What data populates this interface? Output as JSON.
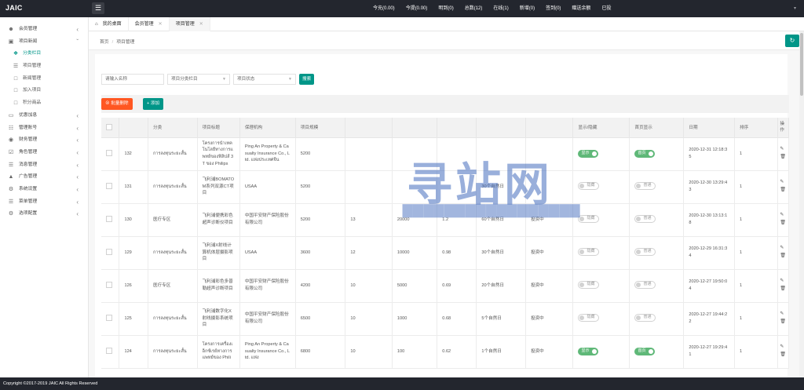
{
  "app": {
    "logo": "JAIC",
    "menu_icon": "menu-icon"
  },
  "topnav": [
    {
      "label": "今充(0.00)"
    },
    {
      "label": "今提(0.00)"
    },
    {
      "label": "明到(0)"
    },
    {
      "label": "总数(12)"
    },
    {
      "label": "在线(1)"
    },
    {
      "label": "新增(0)"
    },
    {
      "label": "签到(0)"
    },
    {
      "label": "赠送余额"
    },
    {
      "label": "已投"
    }
  ],
  "sidebar": {
    "items": [
      {
        "label": "会员管理",
        "icon": "user-icon",
        "type": "group"
      },
      {
        "label": "项目新闻",
        "icon": "news-icon",
        "type": "group"
      },
      {
        "label": "分类栏目",
        "icon": "bullet-icon",
        "type": "sub",
        "active": true
      },
      {
        "label": "项目管理",
        "icon": "cart-icon",
        "type": "sub"
      },
      {
        "label": "新闻管理",
        "icon": "doc-icon",
        "type": "sub"
      },
      {
        "label": "加入项目",
        "icon": "doc-icon",
        "type": "sub"
      },
      {
        "label": "积分商品",
        "icon": "gift-icon",
        "type": "sub"
      },
      {
        "label": "优惠加息",
        "icon": "coupon-icon",
        "type": "group"
      },
      {
        "label": "管理账号",
        "icon": "account-icon",
        "type": "group"
      },
      {
        "label": "财务管理",
        "icon": "finance-icon",
        "type": "group"
      },
      {
        "label": "角色管理",
        "icon": "role-icon",
        "type": "group"
      },
      {
        "label": "消息管理",
        "icon": "message-icon",
        "type": "group"
      },
      {
        "label": "广告管理",
        "icon": "ad-icon",
        "type": "group"
      },
      {
        "label": "系统设置",
        "icon": "settings-icon",
        "type": "group"
      },
      {
        "label": "菜单管理",
        "icon": "menu-list-icon",
        "type": "group"
      },
      {
        "label": "选项配置",
        "icon": "config-icon",
        "type": "group"
      }
    ]
  },
  "tabs": [
    {
      "label": "我的桌面",
      "closable": false
    },
    {
      "label": "会员管理",
      "closable": true
    },
    {
      "label": "项目管理",
      "closable": true,
      "active": true
    }
  ],
  "breadcrumb": {
    "home": "首页",
    "separator": "/",
    "current": "项目管理"
  },
  "search": {
    "name_placeholder": "请输入名称",
    "category_placeholder": "项目分类栏目",
    "status_placeholder": "项目状态",
    "search_label": "搜索"
  },
  "toolbar": {
    "batch_delete_label": "批量删除",
    "add_label": "添加"
  },
  "table": {
    "headers": [
      "",
      "",
      "分类",
      "项目标题",
      "保理机构",
      "项目规模",
      "",
      "",
      "",
      "",
      "",
      "显示/隐藏",
      "首页显示",
      "日期",
      "排序",
      "操作"
    ],
    "rows": [
      {
        "id": "132",
        "category": "การลงทุนระยะสั้น",
        "title": "โครงการนำเทคโนโลยีทางการแพทย์ของฟิลิปส์ 3T ของ Philips",
        "institution": "Ping An Property & Casualty Insurance Co., Ltd. แห่งประเทศจีน",
        "scale": "5200",
        "c6": "",
        "c7": "",
        "c8": "",
        "c9": "",
        "c10": "",
        "show": "显示",
        "show_on": true,
        "home": "首页",
        "home_on": true,
        "date": "2020-12-31 12:18:35",
        "sort": "1"
      },
      {
        "id": "131",
        "category": "การลงทุนระยะสั้น",
        "title": "飞利浦BOMATOM系列双源CT项目",
        "institution": "USAA",
        "scale": "5200",
        "c6": "",
        "c7": "",
        "c8": "",
        "c9": "30个自然日",
        "c10": "",
        "show": "隐藏",
        "show_on": false,
        "home": "普通",
        "home_on": false,
        "date": "2020-12-30 13:29:43",
        "sort": "1"
      },
      {
        "id": "130",
        "category": "医疗专区",
        "title": "飞利浦便携彩色超声诊断仪项目",
        "institution": "中国平安财产保险股份有限公司",
        "scale": "5200",
        "c6": "13",
        "c7": "20000",
        "c8": "1.2",
        "c9": "60个自然日",
        "c10": "投资中",
        "show": "隐藏",
        "show_on": false,
        "home": "普通",
        "home_on": false,
        "date": "2020-12-30 13:13:18",
        "sort": "1"
      },
      {
        "id": "129",
        "category": "การลงทุนระยะสั้น",
        "title": "飞利浦X射线计算机体层摄影项目",
        "institution": "USAA",
        "scale": "3600",
        "c6": "12",
        "c7": "10000",
        "c8": "0.98",
        "c9": "30个自然日",
        "c10": "投资中",
        "show": "隐藏",
        "show_on": false,
        "home": "普通",
        "home_on": false,
        "date": "2020-12-29 16:31:34",
        "sort": "1"
      },
      {
        "id": "126",
        "category": "医疗专区",
        "title": "飞利浦彩色多普勒超声诊断项目",
        "institution": "中国平安财产保险股份有限公司",
        "scale": "4200",
        "c6": "10",
        "c7": "5000",
        "c8": "0.69",
        "c9": "20个自然日",
        "c10": "投资中",
        "show": "隐藏",
        "show_on": false,
        "home": "普通",
        "home_on": false,
        "date": "2020-12-27 19:50:04",
        "sort": "1"
      },
      {
        "id": "125",
        "category": "การลงทุนระยะสั้น",
        "title": "飞利浦数字化X射线摄影系统项目",
        "institution": "中国平安财产保险股份有限公司",
        "scale": "6500",
        "c6": "10",
        "c7": "1000",
        "c8": "0.68",
        "c9": "5个自然日",
        "c10": "投资中",
        "show": "隐藏",
        "show_on": false,
        "home": "普通",
        "home_on": false,
        "date": "2020-12-27 19:44:22",
        "sort": "1"
      },
      {
        "id": "124",
        "category": "การลงทุนระยะสั้น",
        "title": "โครงการเครื่องเอ็กซ์เรย์ทางการแพทย์ของ Phili",
        "institution": "Ping An Property & Casualty Insurance Co., Ltd. แห่ง",
        "scale": "6800",
        "c6": "10",
        "c7": "100",
        "c8": "0.62",
        "c9": "1个自然日",
        "c10": "投资中",
        "show": "显示",
        "show_on": true,
        "home": "首页",
        "home_on": true,
        "date": "2020-12-27 19:29:41",
        "sort": "1"
      }
    ]
  },
  "watermark": {
    "text": "寻站网"
  },
  "footer": {
    "copyright": "Copyright ©2017-2019 JAIC All Rights Reserved"
  }
}
